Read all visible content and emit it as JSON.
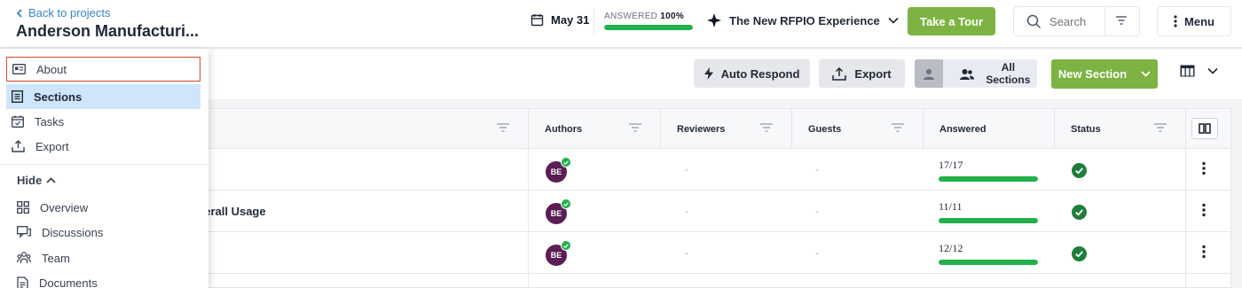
{
  "header": {
    "back_link": "Back to projects",
    "project_title": "Anderson Manufacturi...",
    "due_date": "May 31",
    "answered_label": "ANSWERED",
    "answered_percent": "100%",
    "answered_progress": 1.0,
    "experience_label": "The New RFPIO Experience",
    "tour_button": "Take a Tour",
    "search_placeholder": "Search",
    "menu_button": "Menu"
  },
  "toolbar": {
    "auto_respond": "Auto Respond",
    "export": "Export",
    "all_sections": "All Sections",
    "new_section": "New Section"
  },
  "table": {
    "columns": [
      "Authors",
      "Reviewers",
      "Guests",
      "Answered",
      "Status"
    ],
    "rows": [
      {
        "name": "",
        "author_initials": "BE",
        "reviewers": "-",
        "guests": "-",
        "answered": "17/17",
        "progress": 1.0
      },
      {
        "name": "verall Usage",
        "author_initials": "BE",
        "reviewers": "-",
        "guests": "-",
        "answered": "11/11",
        "progress": 1.0
      },
      {
        "name": "",
        "author_initials": "BE",
        "reviewers": "-",
        "guests": "-",
        "answered": "12/12",
        "progress": 1.0
      }
    ]
  },
  "panel": {
    "items": [
      {
        "label": "About",
        "icon": "id-card-icon"
      },
      {
        "label": "Sections",
        "icon": "list-icon"
      },
      {
        "label": "Tasks",
        "icon": "calendar-check-icon"
      },
      {
        "label": "Export",
        "icon": "export-icon"
      }
    ],
    "hide_label": "Hide",
    "sub_items": [
      {
        "label": "Overview",
        "icon": "dashboard-icon"
      },
      {
        "label": "Discussions",
        "icon": "chat-icon"
      },
      {
        "label": "Team",
        "icon": "team-icon"
      },
      {
        "label": "Documents",
        "icon": "document-icon"
      }
    ]
  },
  "colors": {
    "accent_green": "#7cb342",
    "progress_green": "#22b04b",
    "link_blue": "#3b82c4",
    "active_bg": "#cfe5fb",
    "focus_border": "#d9472b",
    "avatar": "#5b1e54"
  }
}
